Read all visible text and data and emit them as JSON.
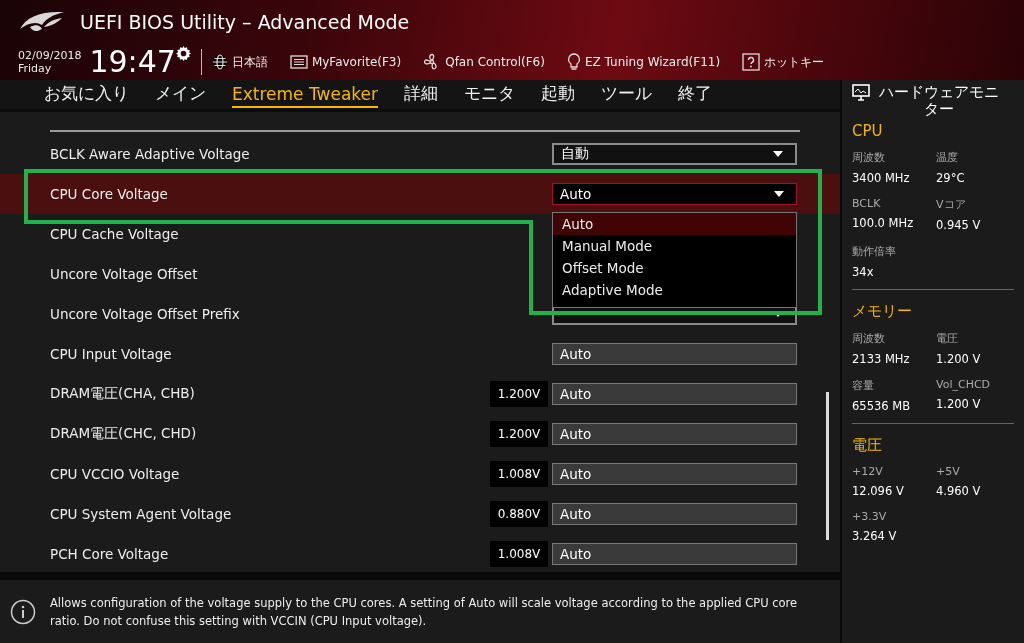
{
  "header": {
    "title": "UEFI BIOS Utility – Advanced Mode",
    "date": "02/09/2018",
    "day": "Friday",
    "time": "19:47",
    "tools": [
      {
        "kind": "language",
        "label": "日本語"
      },
      {
        "kind": "favorite",
        "label": "MyFavorite(F3)"
      },
      {
        "kind": "fan",
        "label": "Qfan Control(F6)"
      },
      {
        "kind": "wizard",
        "label": "EZ Tuning Wizard(F11)"
      },
      {
        "kind": "hotkey",
        "label": "ホットキー"
      }
    ]
  },
  "tabs": [
    {
      "label": "お気に入り",
      "selected": false
    },
    {
      "label": "メイン",
      "selected": false
    },
    {
      "label": "Extreme Tweaker",
      "selected": true
    },
    {
      "label": "詳細",
      "selected": false
    },
    {
      "label": "モニタ",
      "selected": false
    },
    {
      "label": "起動",
      "selected": false
    },
    {
      "label": "ツール",
      "selected": false
    },
    {
      "label": "終了",
      "selected": false
    }
  ],
  "settings": [
    {
      "label": "BCLK Aware Adaptive Voltage",
      "kind": "select",
      "value": "自動",
      "selected": false
    },
    {
      "label": "CPU Core Voltage",
      "kind": "select",
      "value": "Auto",
      "selected": true,
      "dropdown": [
        {
          "label": "Auto",
          "selected": true
        },
        {
          "label": "Manual Mode",
          "selected": false
        },
        {
          "label": "Offset Mode",
          "selected": false
        },
        {
          "label": "Adaptive Mode",
          "selected": false
        }
      ]
    },
    {
      "label": "CPU Cache Voltage",
      "kind": "covered",
      "selected": false
    },
    {
      "label": "Uncore Voltage Offset",
      "kind": "covered",
      "selected": false
    },
    {
      "label": "Uncore Voltage Offset Prefix",
      "kind": "select",
      "selected": false
    },
    {
      "label": "CPU Input Voltage",
      "kind": "field",
      "value": "Auto",
      "selected": false
    },
    {
      "label": "DRAM電圧(CHA, CHB)",
      "kind": "voltage",
      "reading": "1.200V",
      "value": "Auto",
      "selected": false
    },
    {
      "label": "DRAM電圧(CHC, CHD)",
      "kind": "voltage",
      "reading": "1.200V",
      "value": "Auto",
      "selected": false
    },
    {
      "label": "CPU VCCIO Voltage",
      "kind": "voltage",
      "reading": "1.008V",
      "value": "Auto",
      "selected": false
    },
    {
      "label": "CPU System Agent Voltage",
      "kind": "voltage",
      "reading": "0.880V",
      "value": "Auto",
      "selected": false
    },
    {
      "label": "PCH Core Voltage",
      "kind": "voltage",
      "reading": "1.008V",
      "value": "Auto",
      "selected": false
    }
  ],
  "help": "Allows configuration of the voltage supply to the CPU cores. A setting of Auto will scale voltage according to the applied CPU core ratio.  Do not confuse this setting with VCCIN (CPU Input voltage).",
  "monitor": {
    "title": "ハードウェアモニター",
    "sections": [
      {
        "title": "CPU",
        "items": [
          {
            "label": "周波数",
            "value": "3400 MHz"
          },
          {
            "label": "温度",
            "value": "29°C"
          },
          {
            "label": "BCLK",
            "value": "100.0 MHz"
          },
          {
            "label": "Vコア",
            "value": "0.945 V"
          },
          {
            "label": "動作倍率",
            "value": "34x"
          }
        ]
      },
      {
        "title": "メモリー",
        "items": [
          {
            "label": "周波数",
            "value": "2133 MHz"
          },
          {
            "label": "電圧",
            "value": "1.200 V"
          },
          {
            "label": "容量",
            "value": "65536 MB"
          },
          {
            "label": "Vol_CHCD",
            "value": "1.200 V"
          }
        ]
      },
      {
        "title": "電圧",
        "items": [
          {
            "label": "+12V",
            "value": "12.096 V"
          },
          {
            "label": "+5V",
            "value": "4.960 V"
          },
          {
            "label": "+3.3V",
            "value": "3.264 V"
          }
        ]
      }
    ]
  }
}
